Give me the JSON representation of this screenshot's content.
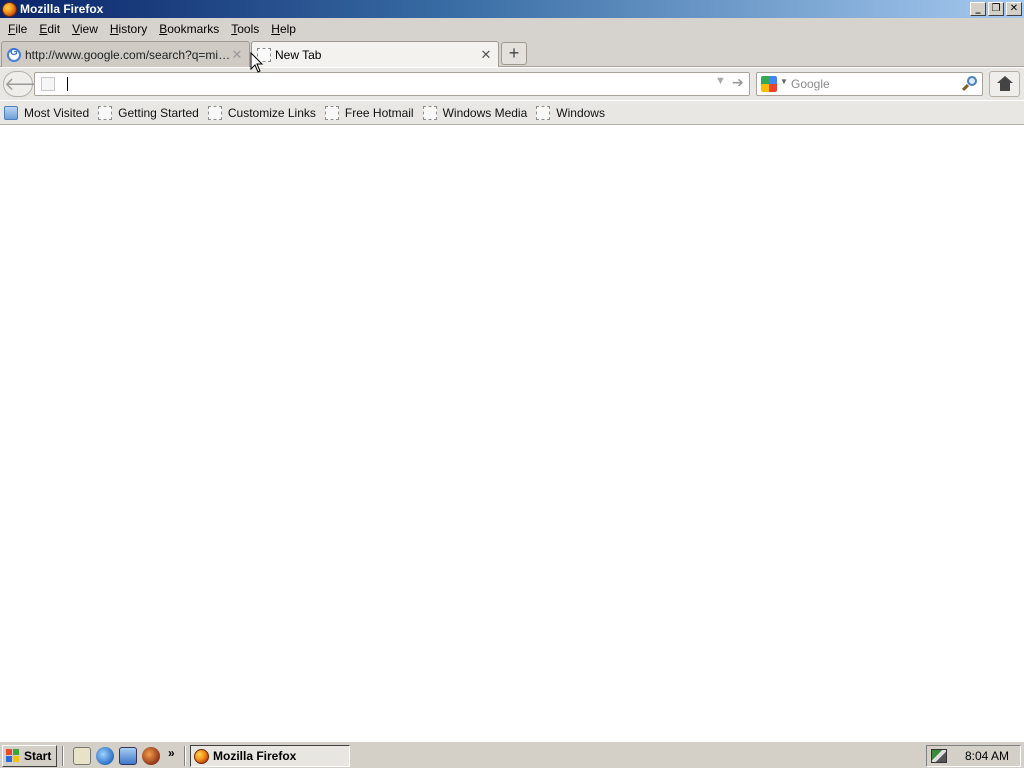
{
  "window": {
    "title": "Mozilla Firefox",
    "icon": "firefox-icon",
    "controls": {
      "minimize": "_",
      "maximize": "❐",
      "close": "✕"
    }
  },
  "menu": [
    {
      "label": "File"
    },
    {
      "label": "Edit"
    },
    {
      "label": "View"
    },
    {
      "label": "History"
    },
    {
      "label": "Bookmarks"
    },
    {
      "label": "Tools"
    },
    {
      "label": "Help"
    }
  ],
  "tabs": [
    {
      "label": "http://www.google.com/search?q=minec...",
      "icon": "google-favicon",
      "active": false,
      "close": "✕"
    },
    {
      "label": "New Tab",
      "icon": "blank-page-icon",
      "active": true,
      "close": "✕"
    }
  ],
  "new_tab_label": "+",
  "navbar": {
    "back_glyph": "🡐",
    "url_value": "",
    "dropdown_glyph": "▼",
    "go_glyph": "➔",
    "search_placeholder": "Google",
    "search_engine_drop": "▼"
  },
  "bookmarks": [
    {
      "label": "Most Visited",
      "icon": "most-visited-icon"
    },
    {
      "label": "Getting Started",
      "icon": "blank-page-icon"
    },
    {
      "label": "Customize Links",
      "icon": "blank-page-icon"
    },
    {
      "label": "Free Hotmail",
      "icon": "blank-page-icon"
    },
    {
      "label": "Windows Media",
      "icon": "blank-page-icon"
    },
    {
      "label": "Windows",
      "icon": "blank-page-icon"
    }
  ],
  "taskbar": {
    "start_label": "Start",
    "quick_launch_more": "»",
    "tasks": [
      {
        "label": "Mozilla Firefox",
        "icon": "firefox-icon"
      }
    ],
    "clock": "8:04 AM"
  }
}
